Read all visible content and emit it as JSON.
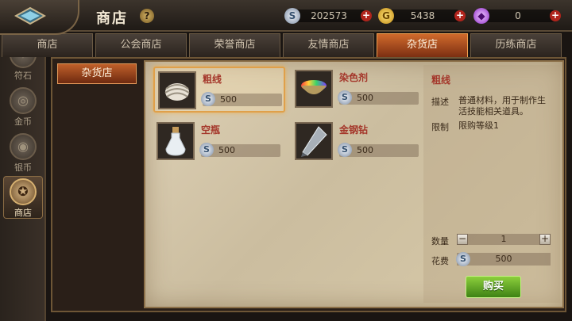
{
  "header": {
    "title": "商店",
    "help_label": "?",
    "currencies": [
      {
        "name": "silver",
        "icon": "silver-coin-icon",
        "glyph": "S",
        "value": "202573",
        "plus": "+"
      },
      {
        "name": "gold",
        "icon": "gold-coin-icon",
        "glyph": "G",
        "value": "5438",
        "plus": "+"
      },
      {
        "name": "gem",
        "icon": "purple-gem-icon",
        "glyph": "◆",
        "value": "0",
        "plus": "+"
      }
    ]
  },
  "sidebar": {
    "items": [
      {
        "label": "符石",
        "icon": "rune-icon",
        "glyph": "✦",
        "active": false
      },
      {
        "label": "金币",
        "icon": "gold-icon",
        "glyph": "◎",
        "active": false
      },
      {
        "label": "银币",
        "icon": "silver-icon",
        "glyph": "◉",
        "active": false
      },
      {
        "label": "商店",
        "icon": "shop-icon",
        "glyph": "✪",
        "active": true
      }
    ]
  },
  "tabs": [
    {
      "label": "商店",
      "active": false
    },
    {
      "label": "公会商店",
      "active": false
    },
    {
      "label": "荣誉商店",
      "active": false
    },
    {
      "label": "友情商店",
      "active": false
    },
    {
      "label": "杂货店",
      "active": true
    },
    {
      "label": "历练商店",
      "active": false
    }
  ],
  "subnav": {
    "label": "杂货店"
  },
  "items": [
    {
      "name": "粗线",
      "icon": "thread-spool-icon",
      "price": "500",
      "coin_glyph": "S",
      "selected": true
    },
    {
      "name": "染色剂",
      "icon": "dye-bowl-icon",
      "price": "500",
      "coin_glyph": "S",
      "selected": false
    },
    {
      "name": "空瓶",
      "icon": "empty-bottle-icon",
      "price": "500",
      "coin_glyph": "S",
      "selected": false
    },
    {
      "name": "金钢钻",
      "icon": "diamond-drill-icon",
      "price": "500",
      "coin_glyph": "S",
      "selected": false
    }
  ],
  "detail": {
    "name": "粗线",
    "desc_label": "描述",
    "desc_value": "普通材料，用于制作生活技能相关道具。",
    "limit_label": "限制",
    "limit_value": "限购等级1",
    "qty_label": "数量",
    "qty_minus": "−",
    "qty_plus": "+",
    "qty_value": "1",
    "cost_label": "花费",
    "cost_glyph": "S",
    "cost_value": "500",
    "buy_label": "购买"
  }
}
